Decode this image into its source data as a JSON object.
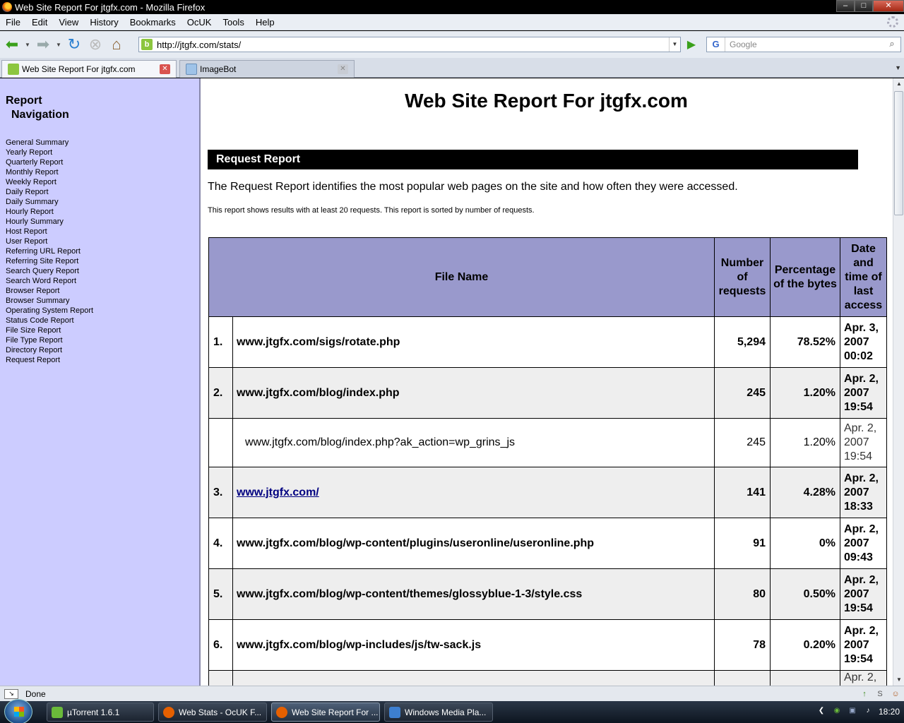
{
  "window": {
    "title": "Web Site Report For jtgfx.com - Mozilla Firefox",
    "controls": [
      "–",
      "□",
      "✕"
    ]
  },
  "menu": [
    "File",
    "Edit",
    "View",
    "History",
    "Bookmarks",
    "OcUK",
    "Tools",
    "Help"
  ],
  "toolbar": {
    "url": "http://jtgfx.com/stats/",
    "search_engine": "G",
    "search_placeholder": "Google"
  },
  "tabs": [
    {
      "label": "Web Site Report For jtgfx.com",
      "active": true
    },
    {
      "label": "ImageBot",
      "active": false
    }
  ],
  "sidebar": {
    "title_line1": "Report",
    "title_line2": "Navigation",
    "links": [
      "General Summary",
      "Yearly Report",
      "Quarterly Report",
      "Monthly Report",
      "Weekly Report",
      "Daily Report",
      "Daily Summary",
      "Hourly Report",
      "Hourly Summary",
      "Host Report",
      "User Report",
      "Referring URL Report",
      "Referring Site Report",
      "Search Query Report",
      "Search Word Report",
      "Browser Report",
      "Browser Summary",
      "Operating System Report",
      "Status Code Report",
      "File Size Report",
      "File Type Report",
      "Directory Report",
      "Request Report"
    ]
  },
  "page": {
    "heading": "Web Site Report For jtgfx.com",
    "section": "Request Report",
    "description": "The Request Report identifies the most popular web pages on the site and how often they were accessed.",
    "note": "This report shows results with at least 20 requests. This report is sorted by number of requests."
  },
  "table": {
    "headers": {
      "file": "File Name",
      "requests": "Number of requests",
      "bytes": "Percentage of the bytes",
      "date": "Date and time of last access"
    },
    "rows": [
      {
        "num": "1.",
        "file": "www.jtgfx.com/sigs/rotate.php",
        "requests": "5,294",
        "bytes": "78.52%",
        "date": "Apr. 3, 2007 00:02"
      },
      {
        "num": "2.",
        "file": "www.jtgfx.com/blog/index.php",
        "requests": "245",
        "bytes": "1.20%",
        "date": "Apr. 2, 2007 19:54"
      },
      {
        "num": "",
        "file": "www.jtgfx.com/blog/index.php?ak_action=wp_grins_js",
        "requests": "245",
        "bytes": "1.20%",
        "date": "Apr. 2, 2007 19:54"
      },
      {
        "num": "3.",
        "file": "www.jtgfx.com/",
        "requests": "141",
        "bytes": "4.28%",
        "date": "Apr. 2, 2007 18:33"
      },
      {
        "num": "4.",
        "file": "www.jtgfx.com/blog/wp-content/plugins/useronline/useronline.php",
        "requests": "91",
        "bytes": "0%",
        "date": "Apr. 2, 2007 09:43"
      },
      {
        "num": "5.",
        "file": "www.jtgfx.com/blog/wp-content/themes/glossyblue-1-3/style.css",
        "requests": "80",
        "bytes": "0.50%",
        "date": "Apr. 2, 2007 19:54"
      },
      {
        "num": "6.",
        "file": "www.jtgfx.com/blog/wp-includes/js/tw-sack.js",
        "requests": "78",
        "bytes": "0.20%",
        "date": "Apr. 2, 2007 19:54"
      },
      {
        "num": "",
        "file": "",
        "requests": "",
        "bytes": "",
        "date": "Apr. 2,"
      }
    ]
  },
  "status": {
    "text": "Done"
  },
  "taskbar": {
    "items": [
      "µTorrent 1.6.1",
      "Web Stats - OcUK F...",
      "Web Site Report For ...",
      "Windows Media Pla..."
    ],
    "clock": "18:20"
  },
  "colors": {
    "sidebar_bg": "#ccccff",
    "table_header_bg": "#9999cc",
    "section_bar_bg": "#000000"
  }
}
